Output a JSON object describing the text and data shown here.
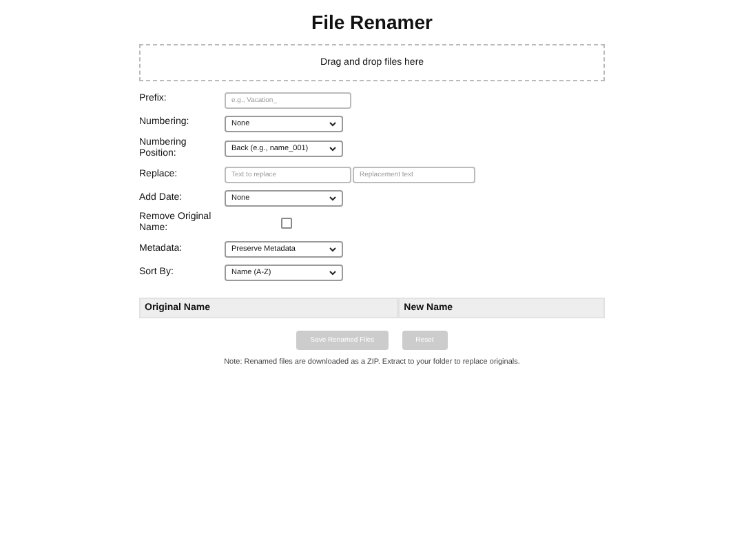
{
  "title": "File Renamer",
  "dropzone": {
    "text": "Drag and drop files here"
  },
  "fields": [
    {
      "kind": "text",
      "label": "Prefix:",
      "inputs": [
        {
          "placeholder": "e.g., Vacation_"
        }
      ]
    },
    {
      "kind": "select",
      "label": "Numbering:",
      "value": "None"
    },
    {
      "kind": "select",
      "label": "Numbering Position:",
      "value": "Back (e.g., name_001)"
    },
    {
      "kind": "text",
      "label": "Replace:",
      "inputs": [
        {
          "placeholder": "Text to replace"
        },
        {
          "placeholder": "Replacement text"
        }
      ]
    },
    {
      "kind": "select",
      "label": "Add Date:",
      "value": "None"
    },
    {
      "kind": "checkbox",
      "label": "Remove Original Name:",
      "checked": false
    },
    {
      "kind": "select",
      "label": "Metadata:",
      "value": "Preserve Metadata"
    },
    {
      "kind": "select",
      "label": "Sort By:",
      "value": "Name (A-Z)"
    }
  ],
  "table": {
    "columns": [
      "Original Name",
      "New Name"
    ]
  },
  "buttons": [
    {
      "label": "Save Renamed Files",
      "disabled": true
    },
    {
      "label": "Reset",
      "disabled": true
    }
  ],
  "note": "Note: Renamed files are downloaded as a ZIP. Extract to your folder to replace originals."
}
